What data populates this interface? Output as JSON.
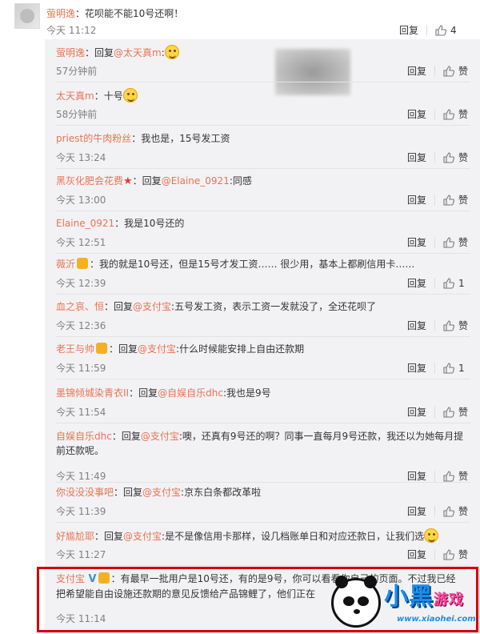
{
  "main_comment": {
    "user": "萤明逸",
    "text": "：花呗能不能10号还啊！",
    "time": "今天 11:12",
    "reply_label": "回复",
    "likes": "4"
  },
  "replies": [
    {
      "user": "萤明逸",
      "badge": "",
      "prefix": "：回复",
      "mention": "@太天真m",
      "text": ":",
      "emoji": true,
      "time": "57分钟前",
      "reply_label": "回复",
      "likes": "赞"
    },
    {
      "user": "太天真m",
      "badge": "",
      "prefix": "：十号",
      "mention": "",
      "text": "",
      "emoji": true,
      "time": "58分钟前",
      "reply_label": "回复",
      "likes": "赞"
    },
    {
      "user": "priest的牛肉粉丝",
      "badge": "",
      "prefix": "：我也是，15号发工资",
      "mention": "",
      "text": "",
      "emoji": false,
      "time": "今天 13:24",
      "reply_label": "回复",
      "likes": "赞"
    },
    {
      "user": "黑灰化肥会花费",
      "badge": "star",
      "prefix": "：回复",
      "mention": "@Elaine_0921",
      "text": ":同感",
      "emoji": false,
      "time": "今天 13:00",
      "reply_label": "回复",
      "likes": "赞"
    },
    {
      "user": "Elaine_0921",
      "badge": "",
      "prefix": "：我是10号还的",
      "mention": "",
      "text": "",
      "emoji": false,
      "time": "今天 12:51",
      "reply_label": "回复",
      "likes": "赞"
    },
    {
      "user": "薇沂",
      "badge": "vip",
      "prefix": "：我的就是10号还，但是15号才发工资…… 很少用，基本上都刷信用卡……",
      "mention": "",
      "text": "",
      "emoji": false,
      "time": "今天 12:39",
      "reply_label": "回复",
      "likes": "1"
    },
    {
      "user": "血之哀、恒",
      "badge": "",
      "prefix": "：回复",
      "mention": "@支付宝",
      "text": ":五号发工资，表示工资一发就没了，全还花呗了",
      "emoji": false,
      "time": "今天 12:36",
      "reply_label": "回复",
      "likes": "赞"
    },
    {
      "user": "老王与帅",
      "badge": "vip",
      "prefix": "：回复",
      "mention": "@支付宝",
      "text": ":什么时候能安排上自由还款期",
      "emoji": false,
      "time": "今天 11:59",
      "reply_label": "回复",
      "likes": "1"
    },
    {
      "user": "墨锦倾城染青衣II",
      "badge": "",
      "prefix": "：回复",
      "mention": "@自娱自乐dhc",
      "text": ":我也是9号",
      "emoji": false,
      "time": "今天 11:54",
      "reply_label": "回复",
      "likes": "赞"
    },
    {
      "user": "自娱自乐dhc",
      "badge": "",
      "prefix": "：回复",
      "mention": "@支付宝",
      "text": ":噢，还真有9号还的啊？同事一直每月9号还款，我还以为她每月提前还款呢。",
      "emoji": false,
      "time": "今天 11:49",
      "reply_label": "回复",
      "likes": "赞"
    },
    {
      "user": "你没没没事吧",
      "badge": "",
      "prefix": "：回复",
      "mention": "@支付宝",
      "text": ":京东白条都改革啦",
      "emoji": false,
      "time": "今天 11:39",
      "reply_label": "回复",
      "likes": "赞"
    },
    {
      "user": "好尴尬耶",
      "badge": "",
      "prefix": "：回复",
      "mention": "@支付宝",
      "text": ":是不是像信用卡那样，设几档账单日和对应还款日，让我们选",
      "emoji": true,
      "time": "今天 11:27",
      "reply_label": "回复",
      "likes": "赞"
    },
    {
      "user": "支付宝",
      "badge": "v-vip",
      "prefix": "：有最早一批用户是10号还，有的是9号，你可以看看你自己的页面。不过我已经把希望能自由设施还款期的意见反馈给产品锦鲤了，他们正在",
      "mention": "",
      "text": "",
      "emoji": false,
      "time": "今天 11:14",
      "reply_label": "",
      "likes": ""
    }
  ],
  "watermark": {
    "logo_main": "小黑",
    "logo_game": "游戏",
    "url": "www.xiaohei.com"
  },
  "colors": {
    "username": "#eb7350",
    "panel_bg": "#f2f2f5",
    "highlight": "#d40000"
  }
}
